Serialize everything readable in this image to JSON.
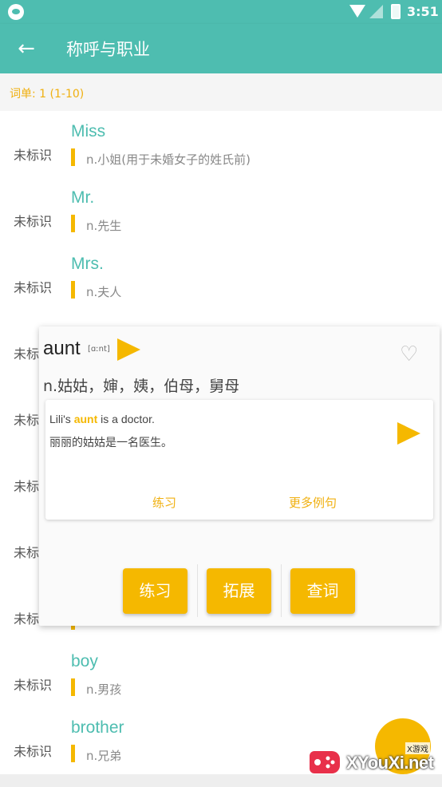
{
  "status_bar": {
    "time": "3:51"
  },
  "toolbar": {
    "back_icon": "arrow-left-icon",
    "title": "称呼与职业"
  },
  "subheader": {
    "text": "词单: 1 (1-10)"
  },
  "words": [
    {
      "status": "未标识",
      "word": "Miss",
      "meaning": "n.小姐(用于未婚女子的姓氏前)"
    },
    {
      "status": "未标识",
      "word": "Mr.",
      "meaning": "n.先生"
    },
    {
      "status": "未标识",
      "word": "Mrs.",
      "meaning": "n.夫人"
    },
    {
      "status": "未标识",
      "word": "",
      "meaning": ""
    },
    {
      "status": "未标识",
      "word": "",
      "meaning": ""
    },
    {
      "status": "未标识",
      "word": "",
      "meaning": ""
    },
    {
      "status": "未标识",
      "word": "",
      "meaning": ""
    },
    {
      "status": "未标识",
      "word": "",
      "meaning": ""
    },
    {
      "status": "未标识",
      "word": "boy",
      "meaning": "n.男孩"
    },
    {
      "status": "未标识",
      "word": "brother",
      "meaning": "n.兄弟"
    }
  ],
  "popup": {
    "word": "aunt",
    "phonetic": "[ɑːnt]",
    "definition": "n.姑姑，婶，姨，伯母，舅母",
    "example_before": "Lili's ",
    "example_highlight": "aunt",
    "example_after": " is a doctor.",
    "example_translation": "丽丽的姑姑是一名医生。",
    "example_link_practice": "练习",
    "example_link_more": "更多例句",
    "buttons": [
      "练习",
      "拓展",
      "查词"
    ]
  },
  "watermark": {
    "text": "XYouXi.net",
    "small": "X游戏"
  },
  "colors": {
    "primary": "#4ebdb0",
    "accent": "#f5b800"
  }
}
